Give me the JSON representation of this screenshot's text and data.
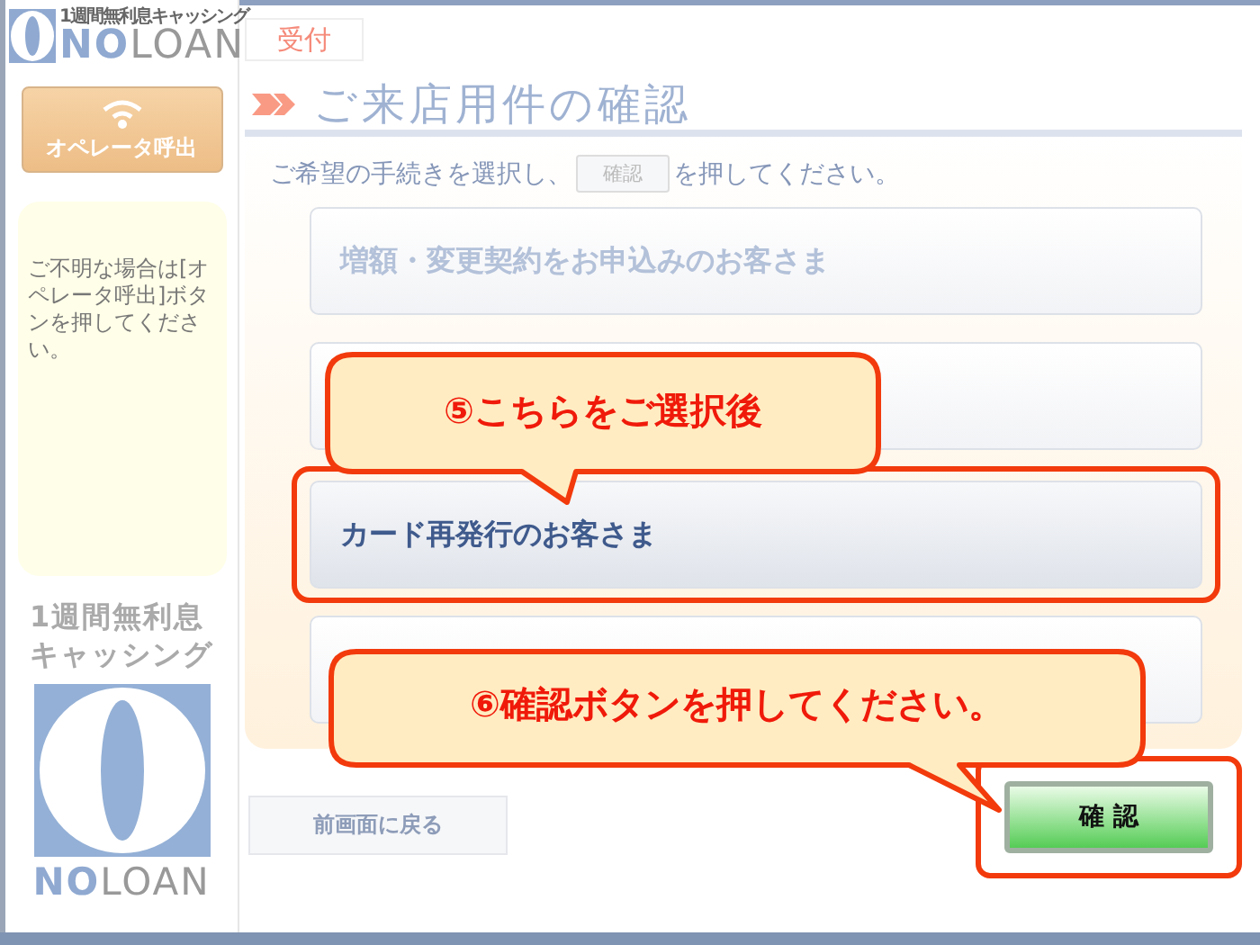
{
  "header": {
    "logo_tagline": "1週間無利息キャッシング",
    "logo_bold": "NO",
    "logo_light": "LOAN"
  },
  "sidebar": {
    "operator_button": "オペレータ呼出",
    "help_text": "ご不明な場合は[オペレータ呼出]ボタンを押してください。",
    "promo": [
      "1週間無利息",
      "キャッシング"
    ],
    "logo_bold": "NO",
    "logo_light": "LOAN"
  },
  "tab": {
    "label": "受付"
  },
  "title": "ご来店用件の確認",
  "instruction": {
    "before": "ご希望の手続きを選択し、",
    "button": "確認",
    "after": "を押してください。"
  },
  "options": [
    {
      "label": "増額・変更契約をお申込みのお客さま",
      "selected": false
    },
    {
      "selected": false
    },
    {
      "label": "カード再発行のお客さま",
      "selected": true
    },
    {
      "selected": false
    }
  ],
  "back_button": "前画面に戻る",
  "confirm_button": {
    "label": "確 認",
    "highlighted": true
  },
  "callouts": [
    {
      "text": "⑤こちらをご選択後"
    },
    {
      "text": "⑥確認ボタンを押してください。"
    }
  ]
}
